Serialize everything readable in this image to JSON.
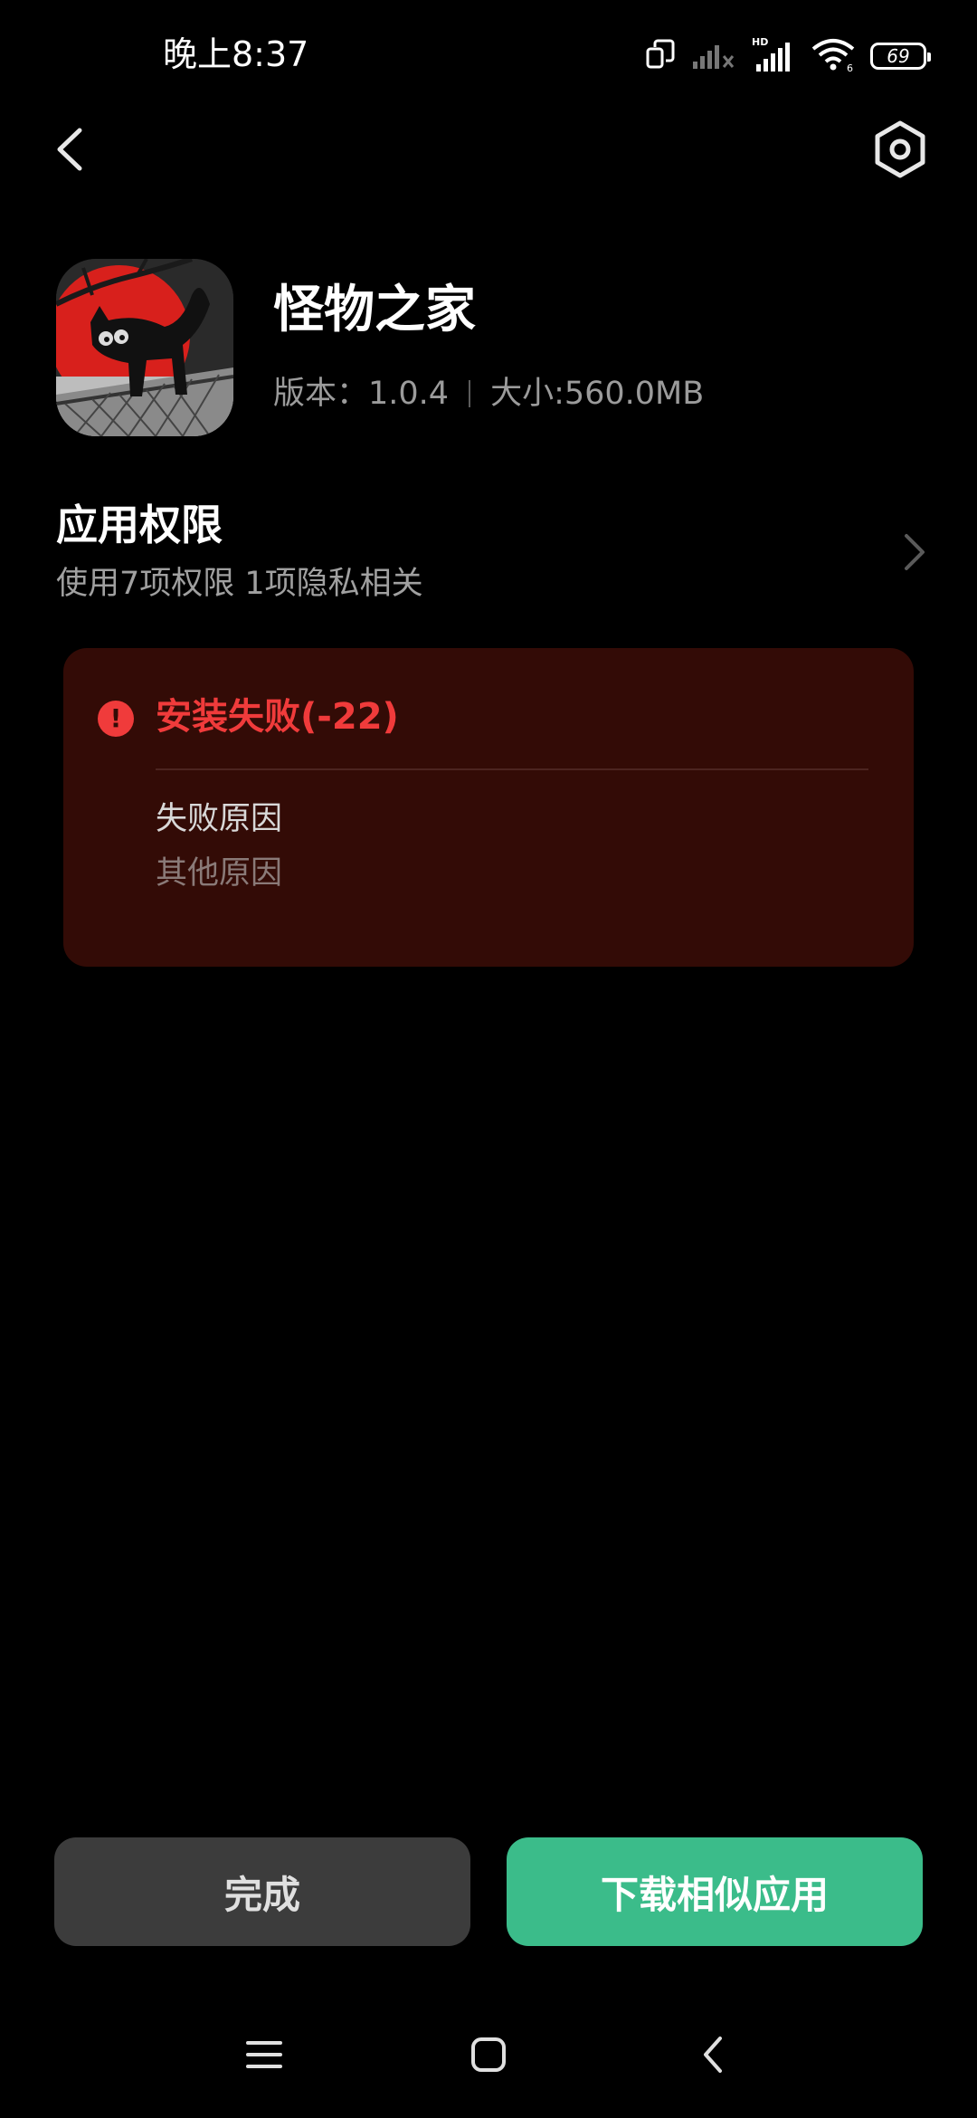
{
  "status_bar": {
    "time": "晚上8:37",
    "battery": "69",
    "icons": [
      "screen-rotate-icon",
      "signal-no-service-icon",
      "hd-signal-icon",
      "wifi-icon",
      "battery-icon"
    ]
  },
  "nav": {
    "back_icon": "chevron-left-icon",
    "settings_icon": "hexagon-gear-icon"
  },
  "app": {
    "name": "怪物之家",
    "version": "版本：1.0.4",
    "size": "大小:560.0MB"
  },
  "permissions": {
    "title": "应用权限",
    "subtitle": "使用7项权限 1项隐私相关"
  },
  "error": {
    "title": "安装失败(-22)",
    "reason_label": "失败原因",
    "reason_value": "其他原因"
  },
  "buttons": {
    "done": "完成",
    "download_similar": "下载相似应用"
  },
  "colors": {
    "background": "#000000",
    "error_red": "#f03b3b",
    "error_card_bg": "#330b06",
    "primary_green": "#3bbc8a",
    "secondary_button": "#3c3c3c"
  }
}
